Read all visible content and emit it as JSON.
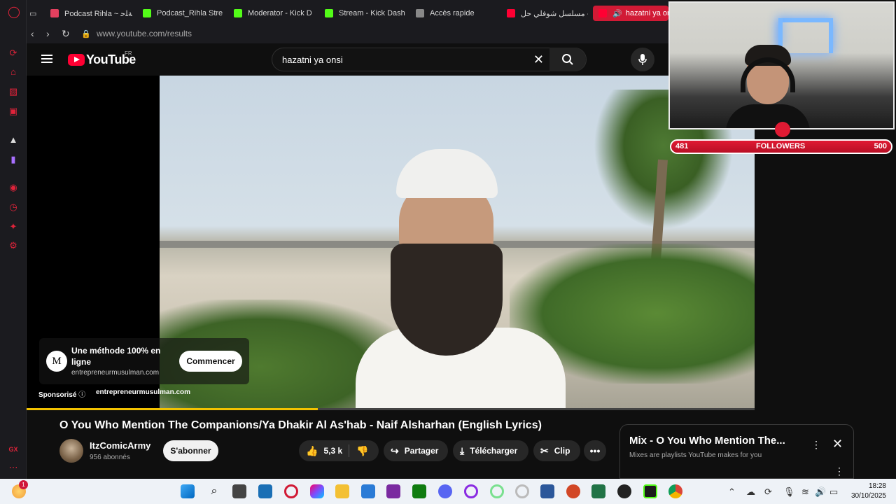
{
  "browser": {
    "tabs": [
      {
        "label": "Podcast Rihla ~ ﺔﻠﺣ",
        "color": "#e4405f"
      },
      {
        "label": "Podcast_Rihla Stre",
        "color": "#53fc18"
      },
      {
        "label": "Moderator - Kick D",
        "color": "#53fc18"
      },
      {
        "label": "Stream - Kick Dash",
        "color": "#53fc18"
      },
      {
        "label": "Accès rapide",
        "color": "#888888"
      },
      {
        "label": "مسلسل شوفلي حل -",
        "color": "#ff0033"
      },
      {
        "label": "hazatni ya on",
        "color": "#ff0033"
      }
    ],
    "url": "www.youtube.com/results"
  },
  "youtube": {
    "logo_text": "YouTube",
    "country": "FR",
    "search_query": "hazatni ya onsi",
    "ad": {
      "logo_letter": "M",
      "title": "Une méthode 100% en ligne",
      "domain": "entrepreneurmusulman.com",
      "cta": "Commencer",
      "sponsored_label": "Sponsorisé",
      "sponsor_domain": "entrepreneurmusulman.com"
    },
    "progress": 0.4,
    "video_title": "O You Who Mention The Companions/Ya Dhakir Al As'hab - Naif Alsharhan (English Lyrics)",
    "channel_name": "ItzComicArmy",
    "subscriber_count": "956 abonnés",
    "subscribe_label": "S'abonner",
    "like_count": "5,3 k",
    "share_label": "Partager",
    "download_label": "Télécharger",
    "clip_label": "Clip",
    "mix": {
      "title": "Mix - O You Who Mention The...",
      "subtitle": "Mixes are playlists YouTube makes for you"
    }
  },
  "stream_overlay": {
    "followers_current": "481",
    "followers_label": "FOLLOWERS",
    "followers_goal": "500",
    "followers_fraction": 0.962
  },
  "sidebar": {
    "bottom_label": "GX"
  },
  "taskbar": {
    "notification_count": "1",
    "time": "18:28",
    "date": "30/10/2025"
  }
}
